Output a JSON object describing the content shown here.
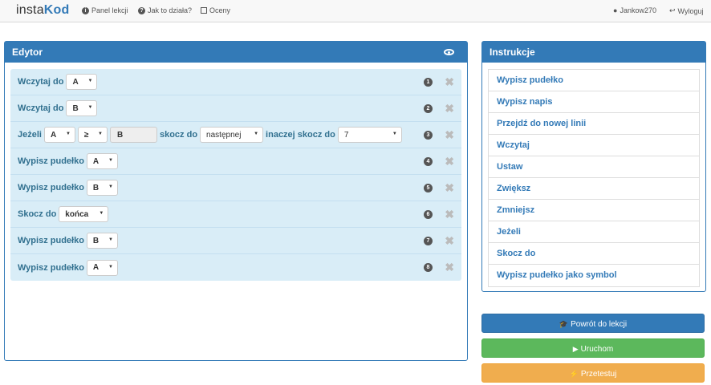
{
  "navbar": {
    "logo_part1": "insta",
    "logo_part2": "Kod",
    "items": [
      {
        "label": "Panel lekcji",
        "icon": "info-icon"
      },
      {
        "label": "Jak to działa?",
        "icon": "question-icon"
      },
      {
        "label": "Oceny",
        "icon": "grades-icon"
      }
    ],
    "user": "Jankow270",
    "logout": "Wyloguj"
  },
  "editor": {
    "title": "Edytor",
    "rows": [
      {
        "num": "1",
        "kw1": "Wczytaj do",
        "sel1": "A"
      },
      {
        "num": "2",
        "kw1": "Wczytaj do",
        "sel1": "B"
      },
      {
        "num": "3",
        "kw1": "Jeżeli",
        "sel1": "A",
        "sel2": "≥",
        "input": "B",
        "kw2": "skocz do",
        "sel3": "następnej",
        "kw3": "inaczej skocz do",
        "sel4": "7"
      },
      {
        "num": "4",
        "kw1": "Wypisz pudełko",
        "sel1": "A"
      },
      {
        "num": "5",
        "kw1": "Wypisz pudełko",
        "sel1": "B"
      },
      {
        "num": "6",
        "kw1": "Skocz do",
        "sel1": "końca"
      },
      {
        "num": "7",
        "kw1": "Wypisz pudełko",
        "sel1": "B"
      },
      {
        "num": "8",
        "kw1": "Wypisz pudełko",
        "sel1": "A"
      }
    ],
    "delete_glyph": "✖"
  },
  "instructions": {
    "title": "Instrukcje",
    "items": [
      "Wypisz pudełko",
      "Wypisz napis",
      "Przejdź do nowej linii",
      "Wczytaj",
      "Ustaw",
      "Zwiększ",
      "Zmniejsz",
      "Jeżeli",
      "Skocz do",
      "Wypisz pudełko jako symbol"
    ]
  },
  "buttons": {
    "back": "Powrót do lekcji",
    "run": "Uruchom",
    "test": "Przetestuj"
  },
  "colors": {
    "primary": "#337ab7",
    "success": "#5cb85c",
    "warning": "#f0ad4e",
    "row_bg": "#d9edf7"
  }
}
